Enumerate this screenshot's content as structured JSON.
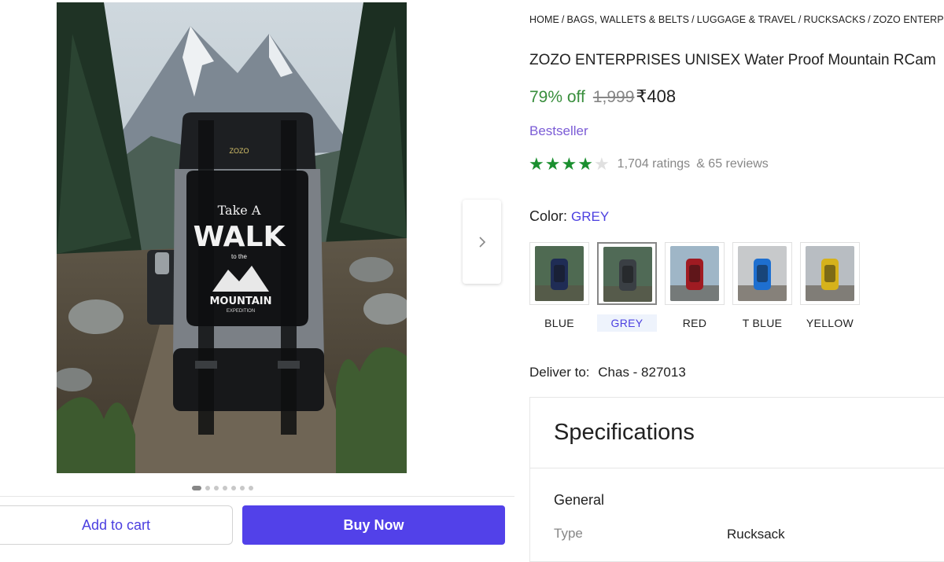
{
  "gallery": {
    "bag_print": {
      "line1": "Take A",
      "line2": "WALK",
      "line3": "to the",
      "line4": "MOUNTAIN",
      "line5": "EXPEDITION"
    },
    "bag_brand": "ZOZO",
    "next_icon": "chevron-right-icon",
    "dots_total": 7,
    "active_dot": 0
  },
  "actions": {
    "add_to_cart": "Add to cart",
    "buy_now": "Buy Now"
  },
  "breadcrumb": [
    "HOME",
    "BAGS, WALLETS & BELTS",
    "LUGGAGE & TRAVEL",
    "RUCKSACKS",
    "ZOZO ENTERPRIS"
  ],
  "product": {
    "title": "ZOZO ENTERPRISES UNISEX Water Proof Mountain RCam",
    "discount": "79% off",
    "mrp": "1,999",
    "price": "₹408",
    "badge": "Bestseller",
    "rating": {
      "stars": 4,
      "max": 5,
      "ratings_text": "1,704 ratings",
      "reviews_text": "& 65 reviews"
    }
  },
  "color": {
    "label": "Color:",
    "selected": "GREY",
    "options": [
      {
        "name": "BLUE",
        "bag": "#1f2c55",
        "bg": "#4f6a52"
      },
      {
        "name": "GREY",
        "bag": "#3a3f44",
        "bg": "#506a56"
      },
      {
        "name": "RED",
        "bag": "#a01b22",
        "bg": "#9fb6c7"
      },
      {
        "name": "T BLUE",
        "bag": "#1e6fd0",
        "bg": "#c7c9cb"
      },
      {
        "name": "YELLOW",
        "bag": "#d6b21b",
        "bg": "#b8bdc2"
      }
    ]
  },
  "delivery": {
    "label": "Deliver to:",
    "location": "Chas - 827013"
  },
  "specifications": {
    "title": "Specifications",
    "group": "General",
    "rows": [
      {
        "key": "Type",
        "value": "Rucksack"
      }
    ]
  },
  "colors": {
    "accent": "#5241e9",
    "discount": "#388e3c",
    "star": "#1a8f2f",
    "bestseller": "#7b5cd6"
  }
}
